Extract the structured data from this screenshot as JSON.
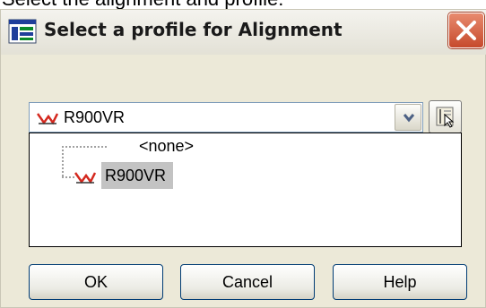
{
  "caption": "Select the alignment and profile:",
  "dialog": {
    "title": "Select a profile for Alignment",
    "close_icon": "close-icon"
  },
  "profile_dropdown": {
    "selected": "R900VR",
    "icon": "profile-icon"
  },
  "pick_button": {
    "icon": "pick-from-drawing-icon"
  },
  "tree": {
    "items": [
      {
        "label": "<none>"
      },
      {
        "label": "R900VR",
        "selected": true,
        "icon": "profile-icon"
      }
    ]
  },
  "buttons": {
    "ok": "OK",
    "cancel": "Cancel",
    "help": "Help"
  },
  "colors": {
    "dialog_bg": "#ece9d8",
    "close_red": "#c64a2c",
    "selection": "#c3c3c3",
    "profile_icon_red": "#d4281e"
  }
}
